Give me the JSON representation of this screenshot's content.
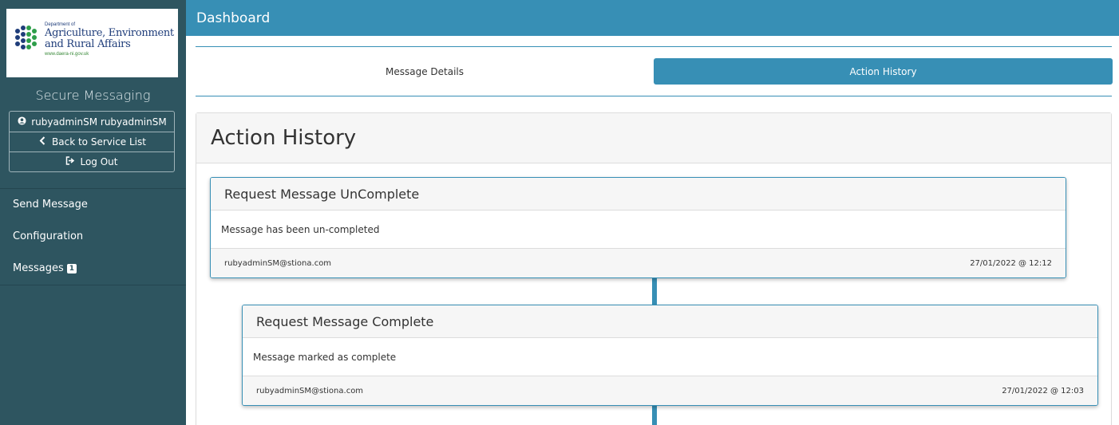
{
  "logo": {
    "dept": "Department of",
    "line1": "Agriculture, Environment",
    "line2": "and Rural Affairs",
    "url": "www.daera-ni.gov.uk"
  },
  "app_title": "Secure Messaging",
  "user_menu": {
    "user": "rubyadminSM rubyadminSM",
    "back": "Back to Service List",
    "logout": "Log Out"
  },
  "nav": {
    "send": "Send Message",
    "config": "Configuration",
    "messages": "Messages",
    "messages_badge": "1"
  },
  "topbar_title": "Dashboard",
  "tabs": {
    "details": "Message Details",
    "history": "Action History"
  },
  "panel_title": "Action History",
  "events": [
    {
      "title": "Request Message UnComplete",
      "body": "Message has been un-completed",
      "user": "rubyadminSM@stiona.com",
      "time": "27/01/2022 @ 12:12"
    },
    {
      "title": "Request Message Complete",
      "body": "Message marked as complete",
      "user": "rubyadminSM@stiona.com",
      "time": "27/01/2022 @ 12:03"
    }
  ],
  "colors": {
    "sidebar": "#2e5560",
    "accent": "#378fb5"
  }
}
